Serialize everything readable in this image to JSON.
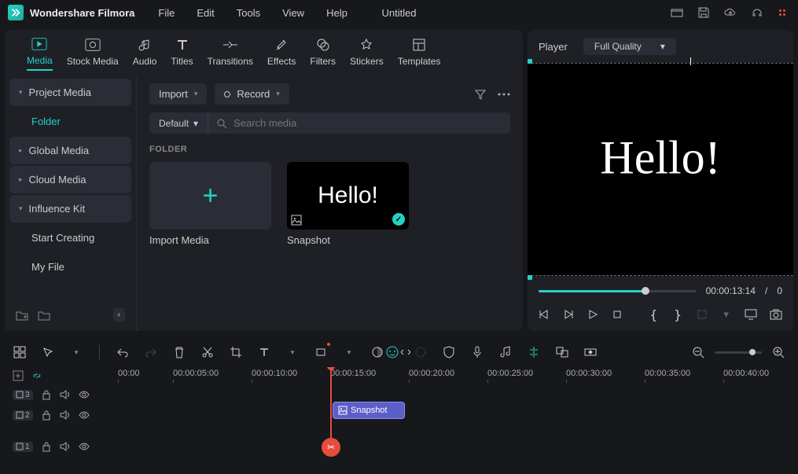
{
  "app": {
    "name": "Wondershare Filmora",
    "document": "Untitled"
  },
  "menu": [
    "File",
    "Edit",
    "Tools",
    "View",
    "Help"
  ],
  "tabs": [
    {
      "id": "media",
      "label": "Media",
      "active": true
    },
    {
      "id": "stock",
      "label": "Stock Media"
    },
    {
      "id": "audio",
      "label": "Audio"
    },
    {
      "id": "titles",
      "label": "Titles"
    },
    {
      "id": "transitions",
      "label": "Transitions"
    },
    {
      "id": "effects",
      "label": "Effects"
    },
    {
      "id": "filters",
      "label": "Filters"
    },
    {
      "id": "stickers",
      "label": "Stickers"
    },
    {
      "id": "templates",
      "label": "Templates"
    }
  ],
  "sidebar": {
    "items": [
      {
        "label": "Project Media",
        "chevron": true
      },
      {
        "label": "Folder",
        "active": true,
        "sub": true
      },
      {
        "label": "Global Media",
        "chevron": true
      },
      {
        "label": "Cloud Media",
        "chevron": true
      },
      {
        "label": "Influence Kit",
        "chevron": true
      },
      {
        "label": "Start Creating",
        "sub": true
      },
      {
        "label": "My File",
        "sub": true
      }
    ]
  },
  "content": {
    "import_label": "Import",
    "record_label": "Record",
    "default_label": "Default",
    "search_placeholder": "Search media",
    "folder_label": "FOLDER",
    "tiles": [
      {
        "id": "import",
        "caption": "Import Media",
        "type": "plus"
      },
      {
        "id": "snapshot",
        "caption": "Snapshot",
        "type": "hello",
        "text": "Hello!"
      }
    ]
  },
  "player": {
    "label": "Player",
    "quality": "Full Quality",
    "preview_text": "Hello!",
    "current_time": "00:00:13:14",
    "duration_prefix": "/",
    "duration_partial": "0",
    "progress_pct": 68
  },
  "timeline": {
    "ruler": [
      "00:00",
      "00:00:05:00",
      "00:00:10:00",
      "00:00:15:00",
      "00:00:20:00",
      "00:00:25:00",
      "00:00:30:00",
      "00:00:35:00",
      "00:00:40:00"
    ],
    "tracks": [
      {
        "badge": "3",
        "icon": "image"
      },
      {
        "badge": "2",
        "icon": "image"
      },
      {
        "badge": "1",
        "icon": "image"
      }
    ],
    "clip_label": "Snapshot"
  }
}
